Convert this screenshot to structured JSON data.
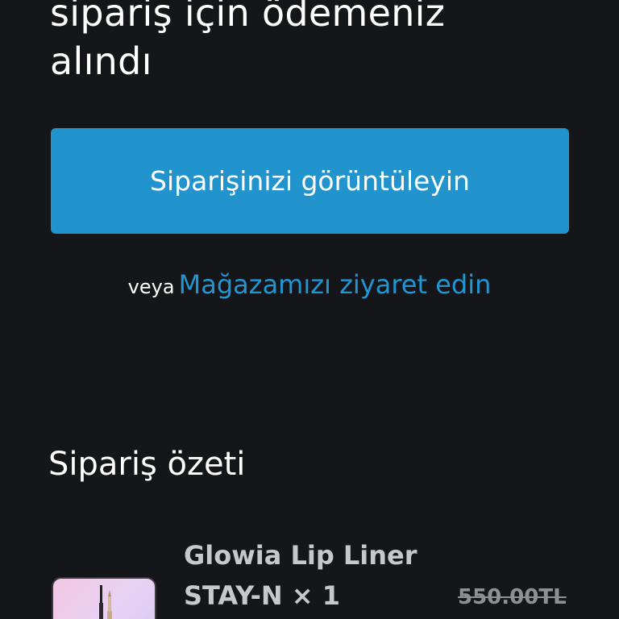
{
  "confirmation": {
    "heading_line1": "sipariş için ödemeniz",
    "heading_line2": "alındı"
  },
  "actions": {
    "view_order_label": "Siparişinizi görüntüleyin",
    "alt_prefix": "veya",
    "visit_store_label": "Mağazamızı ziyaret edin"
  },
  "summary": {
    "title": "Sipariş özeti",
    "items": [
      {
        "name_line1": "Glowia Lip Liner",
        "name_line2": "STAY-N × 1",
        "original_price": "550.00TL",
        "thumbnail": "lip-liner-product-image"
      }
    ]
  },
  "colors": {
    "background": "#15161a",
    "accent": "#2194ce",
    "link": "#2196d3",
    "muted_text": "#c7c8cc"
  }
}
